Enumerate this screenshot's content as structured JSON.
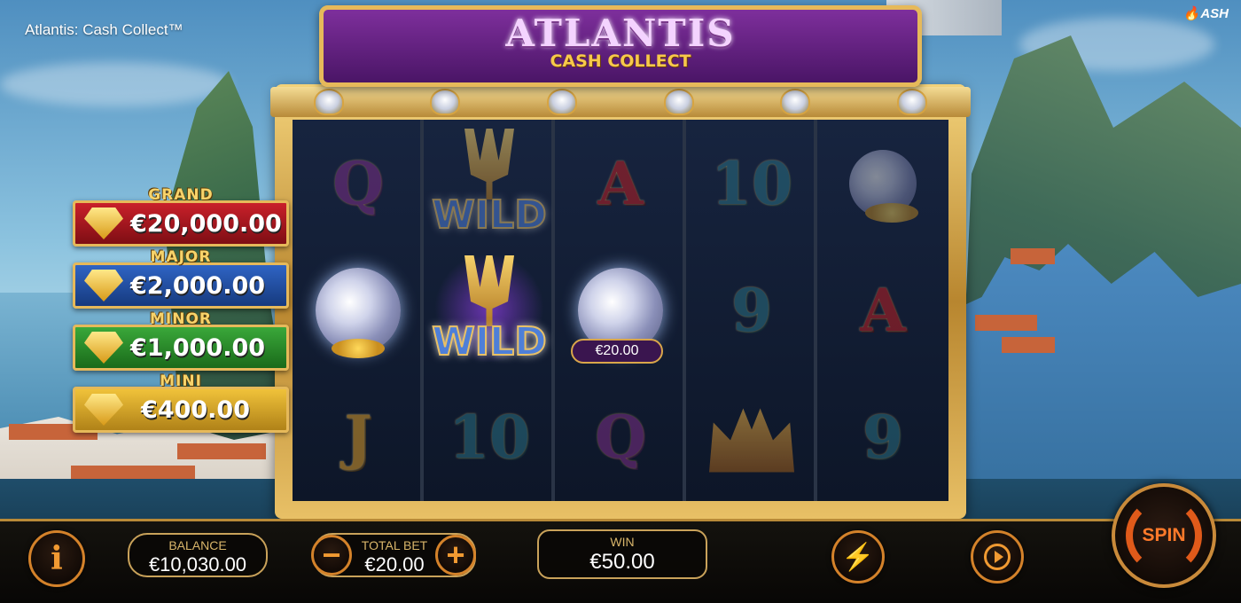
{
  "window": {
    "title": "Atlantis: Cash Collect™",
    "brand": "ASH"
  },
  "banner": {
    "title": "ATLANTIS",
    "subtitle": "CASH COLLECT"
  },
  "jackpots": [
    {
      "name": "GRAND",
      "value": "€20,000.00",
      "color": "#c9202a"
    },
    {
      "name": "MAJOR",
      "value": "€2,000.00",
      "color": "#2f64c4"
    },
    {
      "name": "MINOR",
      "value": "€1,000.00",
      "color": "#3aa83a"
    },
    {
      "name": "MINI",
      "value": "€400.00",
      "color": "#f0c23a"
    }
  ],
  "reels": [
    [
      "Q",
      "cash-shell",
      "J"
    ],
    [
      "WILD",
      "WILD",
      "10"
    ],
    [
      "A",
      "cash-shell",
      "Q"
    ],
    [
      "10",
      "9",
      "crown"
    ],
    [
      "cash-shell",
      "A",
      "9"
    ]
  ],
  "cash_values": {
    "reel3_row2": "€20.00"
  },
  "controls": {
    "info_label": "i",
    "balance_label": "BALANCE",
    "balance_value": "€10,030.00",
    "bet_label": "TOTAL BET",
    "bet_value": "€20.00",
    "minus_label": "−",
    "plus_label": "+",
    "win_label": "WIN",
    "win_value": "€50.00",
    "turbo_icon": "lightning-icon",
    "autoplay_icon": "autoplay-icon",
    "spin_label": "SPIN"
  },
  "colors": {
    "accent": "#e05a1a",
    "gold": "#e6b95a",
    "banner": "#7e2f9c"
  }
}
